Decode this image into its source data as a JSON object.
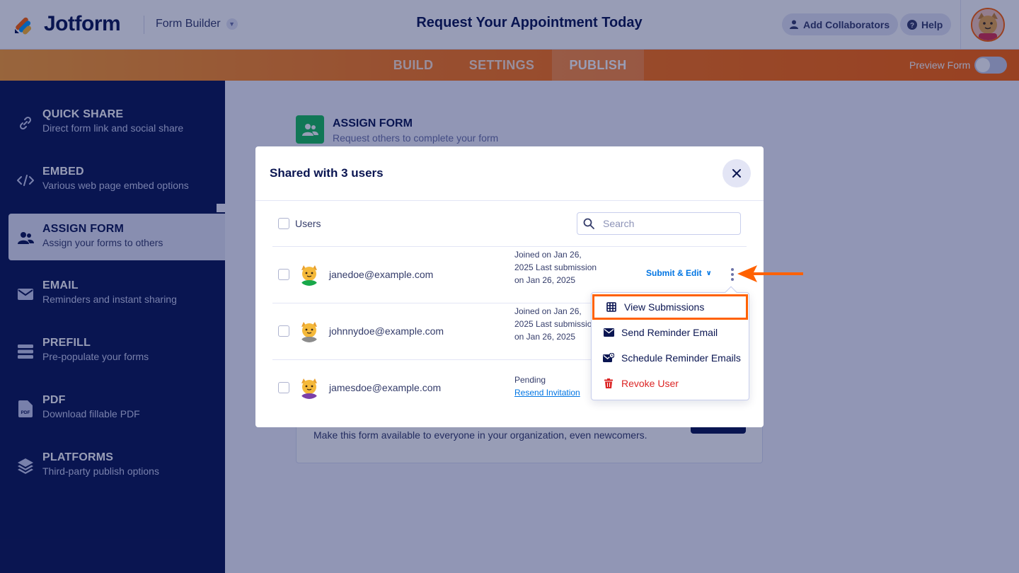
{
  "header": {
    "logo_text": "Jotform",
    "builder_label": "Form Builder",
    "form_title": "Request Your Appointment Today",
    "add_collaborators": "Add Collaborators",
    "help": "Help"
  },
  "tabs": [
    {
      "label": "BUILD",
      "active": false
    },
    {
      "label": "SETTINGS",
      "active": false
    },
    {
      "label": "PUBLISH",
      "active": true
    }
  ],
  "preview": {
    "label": "Preview Form",
    "enabled": false
  },
  "sidebar": {
    "items": [
      {
        "title": "QUICK SHARE",
        "subtitle": "Direct form link and social share",
        "icon": "link-icon"
      },
      {
        "title": "EMBED",
        "subtitle": "Various web page embed options",
        "icon": "code-icon"
      },
      {
        "title": "ASSIGN FORM",
        "subtitle": "Assign your forms to others",
        "icon": "users-icon",
        "active": true
      },
      {
        "title": "EMAIL",
        "subtitle": "Reminders and instant sharing",
        "icon": "envelope-icon"
      },
      {
        "title": "PREFILL",
        "subtitle": "Pre-populate your forms",
        "icon": "prefill-icon"
      },
      {
        "title": "PDF",
        "subtitle": "Download fillable PDF",
        "icon": "pdf-icon"
      },
      {
        "title": "PLATFORMS",
        "subtitle": "Third-party publish options",
        "icon": "layers-icon"
      }
    ]
  },
  "main": {
    "assign_title": "ASSIGN FORM",
    "assign_subtitle": "Request others to complete your form",
    "org_text": "Make this form available to everyone in your organization, even newcomers."
  },
  "modal": {
    "title": "Shared with 3 users",
    "users_header": "Users",
    "search_placeholder": "Search",
    "users": [
      {
        "email": "janedoe@example.com",
        "meta": "Joined on Jan 26, 2025 Last submission on Jan 26, 2025",
        "permission": "Submit & Edit"
      },
      {
        "email": "johnnydoe@example.com",
        "meta": "Joined on Jan 26, 2025 Last submission on Jan 26, 2025"
      },
      {
        "email": "jamesdoe@example.com",
        "status": "Pending",
        "action": "Resend Invitation"
      }
    ]
  },
  "dropdown": {
    "items": [
      {
        "label": "View Submissions",
        "icon": "table-icon",
        "highlighted": true
      },
      {
        "label": "Send Reminder Email",
        "icon": "envelope-icon"
      },
      {
        "label": "Schedule Reminder Emails",
        "icon": "schedule-email-icon"
      },
      {
        "label": "Revoke User",
        "icon": "trash-icon",
        "danger": true
      }
    ]
  },
  "colors": {
    "brand_navy": "#0a1551",
    "accent_orange": "#ff6100",
    "link_blue": "#0075e3",
    "danger_red": "#dc2626"
  }
}
